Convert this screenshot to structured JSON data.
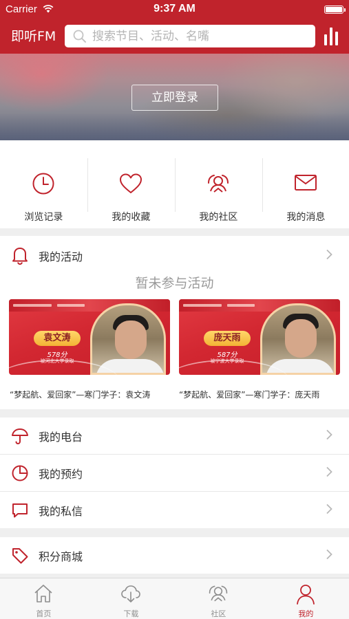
{
  "status_bar": {
    "carrier": "Carrier",
    "time": "9:37 AM"
  },
  "header": {
    "brand": "即听FM",
    "search_placeholder": "搜索节目、活动、名嘴"
  },
  "banner": {
    "login_label": "立即登录"
  },
  "quick_actions": [
    {
      "label": "浏览记录",
      "icon": "clock-icon"
    },
    {
      "label": "我的收藏",
      "icon": "heart-icon"
    },
    {
      "label": "我的社区",
      "icon": "community-icon"
    },
    {
      "label": "我的消息",
      "icon": "envelope-icon"
    }
  ],
  "activity": {
    "title": "我的活动",
    "empty_text": "暂未参与活动",
    "cards": [
      {
        "name": "袁文涛",
        "score": "578分",
        "school": "被河北大学录取",
        "caption": "“梦起航、爱回家”—寒门学子：袁文涛"
      },
      {
        "name": "庞天雨",
        "score": "587分",
        "school": "被宁波大学录取",
        "caption": "“梦起航、爱回家”—寒门学子：庞天雨"
      }
    ]
  },
  "menu": [
    {
      "label": "我的电台",
      "icon": "umbrella-icon"
    },
    {
      "label": "我的预约",
      "icon": "pie-chart-icon"
    },
    {
      "label": "我的私信",
      "icon": "chat-bubble-icon"
    }
  ],
  "shop": {
    "label": "积分商城",
    "icon": "tag-icon"
  },
  "tabs": [
    {
      "label": "首页",
      "icon": "home-icon",
      "active": false
    },
    {
      "label": "下载",
      "icon": "cloud-download-icon",
      "active": false
    },
    {
      "label": "社区",
      "icon": "community-icon",
      "active": false
    },
    {
      "label": "我的",
      "icon": "person-icon",
      "active": true
    }
  ],
  "colors": {
    "brand_red": "#c0232c",
    "background": "#efefef",
    "muted_text": "#9a9a9a"
  }
}
